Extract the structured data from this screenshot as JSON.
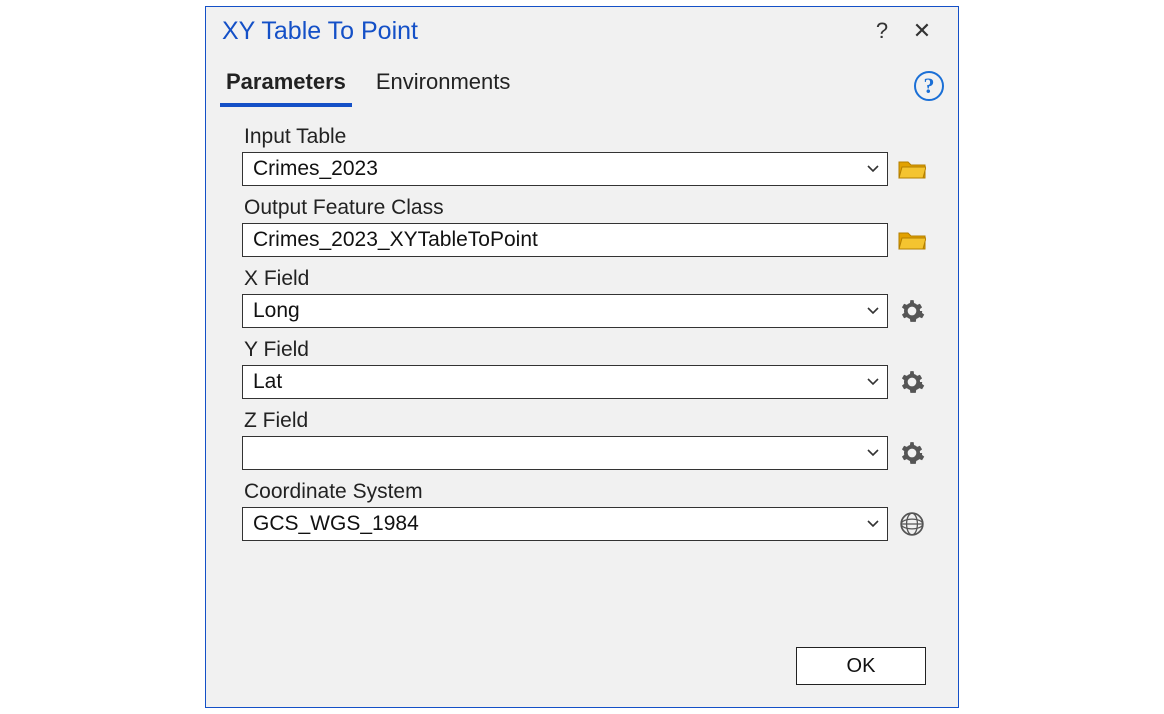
{
  "dialog": {
    "title": "XY Table To Point",
    "help_tooltip": "?",
    "close_tooltip": "✕"
  },
  "tabs": {
    "parameters": "Parameters",
    "environments": "Environments"
  },
  "fields": {
    "input_table": {
      "label": "Input Table",
      "value": "Crimes_2023"
    },
    "output_fc": {
      "label": "Output Feature Class",
      "value": "Crimes_2023_XYTableToPoint"
    },
    "x_field": {
      "label": "X Field",
      "value": "Long"
    },
    "y_field": {
      "label": "Y Field",
      "value": "Lat"
    },
    "z_field": {
      "label": "Z Field",
      "value": ""
    },
    "coord_sys": {
      "label": "Coordinate System",
      "value": "GCS_WGS_1984"
    }
  },
  "footer": {
    "ok": "OK"
  }
}
